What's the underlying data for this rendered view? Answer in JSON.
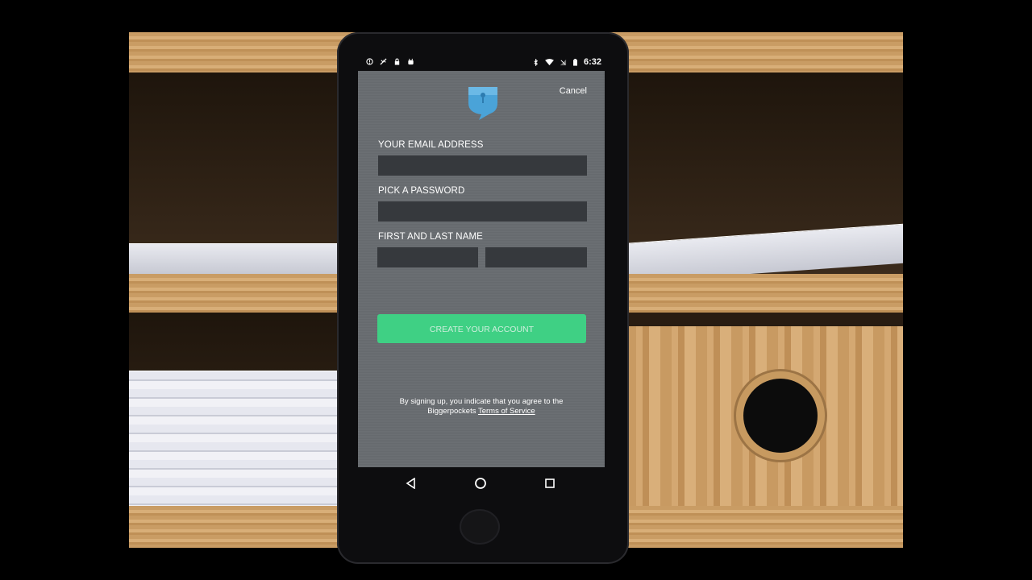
{
  "status_bar": {
    "time": "6:32"
  },
  "header": {
    "logo_icon": "biggerpockets-pocket-logo",
    "cancel_label": "Cancel"
  },
  "form": {
    "email_label": "YOUR EMAIL ADDRESS",
    "email_value": "",
    "password_label": "PICK A PASSWORD",
    "password_value": "",
    "name_label": "FIRST AND LAST NAME",
    "first_name_value": "",
    "last_name_value": "",
    "submit_label": "CREATE YOUR ACCOUNT"
  },
  "terms": {
    "line1": "By signing up, you indicate that you agree to the",
    "prefix": "Biggerpockets",
    "link": "Terms of Service"
  },
  "colors": {
    "accent_green": "#3fd084",
    "screen_gray": "#696d71",
    "field_dark": "#36393d",
    "logo_blue": "#4aa3d8"
  }
}
